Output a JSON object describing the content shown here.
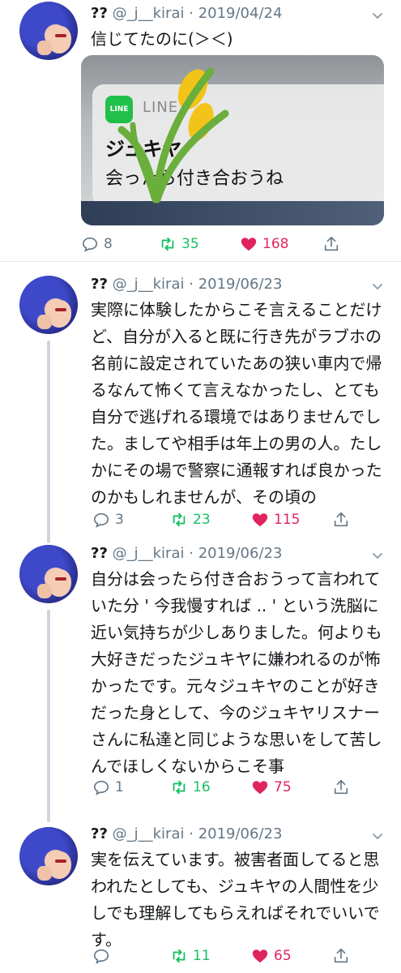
{
  "tweets": [
    {
      "name": "??",
      "handle": "@_j__kirai",
      "sep": "·",
      "date": "2019/04/24",
      "text": "信じてたのに(＞＜)",
      "media": {
        "app_icon_text": "LINE",
        "app_label": "LINE",
        "sender": "ジュキヤ",
        "message": "会ったら付き合おうね"
      },
      "reply_count": "8",
      "retweet_count": "35",
      "like_count": "168"
    },
    {
      "name": "??",
      "handle": "@_j__kirai",
      "sep": "·",
      "date": "2019/06/23",
      "text": "実際に体験したからこそ言えることだけど、自分が入ると既に行き先がラブホの名前に設定されていたあの狭い車内で帰るなんて怖くて言えなかったし、とても自分で逃げれる環境ではありませんでした。ましてや相手は年上の男の人。たしかにその場で警察に通報すれば良かったのかもしれませんが、その頃の",
      "reply_count": "3",
      "retweet_count": "23",
      "like_count": "115"
    },
    {
      "name": "??",
      "handle": "@_j__kirai",
      "sep": "·",
      "date": "2019/06/23",
      "text": "自分は会ったら付き合おうって言われていた分 ' 今我慢すれば .. ' という洗脳に近い気持ちが少しありました。何よりも大好きだったジュキヤに嫌われるのが怖かったです。元々ジュキヤのことが好きだった身として、今のジュキヤリスナーさんに私達と同じような思いをして苦しんでほしくないからこそ事",
      "reply_count": "1",
      "retweet_count": "16",
      "like_count": "75"
    },
    {
      "name": "??",
      "handle": "@_j__kirai",
      "sep": "·",
      "date": "2019/06/23",
      "text": "実を伝えています。被害者面してると思われたとしても、ジュキヤの人間性を少しでも理解してもらえればそれでいいです。",
      "reply_count": "",
      "retweet_count": "11",
      "like_count": "65"
    }
  ],
  "colors": {
    "retweet": "#17bf63",
    "like": "#e0245e",
    "muted": "#657786",
    "line_green": "#21c04b"
  },
  "icons": [
    "reply-icon",
    "retweet-icon",
    "like-icon",
    "share-icon",
    "chevron-down-icon"
  ]
}
